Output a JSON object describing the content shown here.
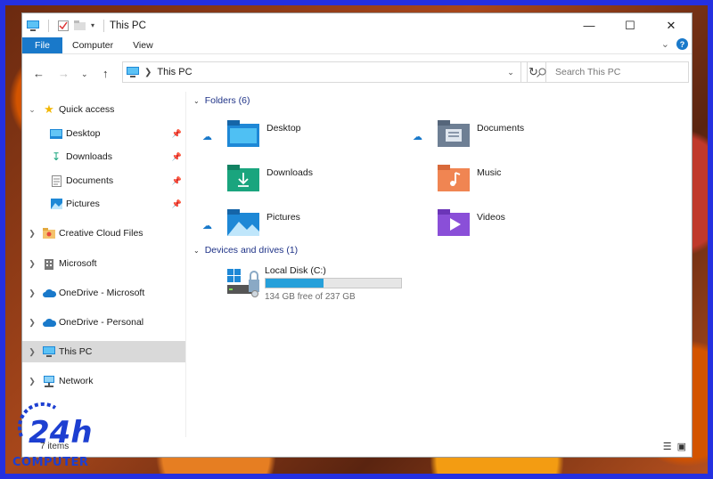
{
  "window": {
    "title": "This PC"
  },
  "ribbon": {
    "tabs": [
      "File",
      "Computer",
      "View"
    ],
    "help": "?"
  },
  "nav": {
    "address_current": "This PC",
    "search_placeholder": "Search This PC"
  },
  "sidebar": {
    "items": [
      {
        "label": "Quick access"
      },
      {
        "label": "Desktop"
      },
      {
        "label": "Downloads"
      },
      {
        "label": "Documents"
      },
      {
        "label": "Pictures"
      },
      {
        "label": "Creative Cloud Files"
      },
      {
        "label": "Microsoft"
      },
      {
        "label": "OneDrive - Microsoft"
      },
      {
        "label": "OneDrive - Personal"
      },
      {
        "label": "This PC"
      },
      {
        "label": "Network"
      }
    ]
  },
  "content": {
    "folders_header": "Folders (6)",
    "folders": [
      {
        "label": "Desktop",
        "icon": "desktop-folder-icon"
      },
      {
        "label": "Documents",
        "icon": "documents-folder-icon"
      },
      {
        "label": "Downloads",
        "icon": "downloads-folder-icon"
      },
      {
        "label": "Music",
        "icon": "music-folder-icon"
      },
      {
        "label": "Pictures",
        "icon": "pictures-folder-icon"
      },
      {
        "label": "Videos",
        "icon": "videos-folder-icon"
      }
    ],
    "drives_header": "Devices and drives (1)",
    "drive": {
      "label": "Local Disk (C:)",
      "free_text": "134 GB free of 237 GB",
      "used_fraction": 0.43
    }
  },
  "status": {
    "count": "7 items"
  },
  "watermark": {
    "number": "24h",
    "brand": "COMPUTER"
  },
  "colors": {
    "accent": "#1979ca",
    "selection": "#d9d9d9",
    "drive_bar": "#26a0da"
  }
}
